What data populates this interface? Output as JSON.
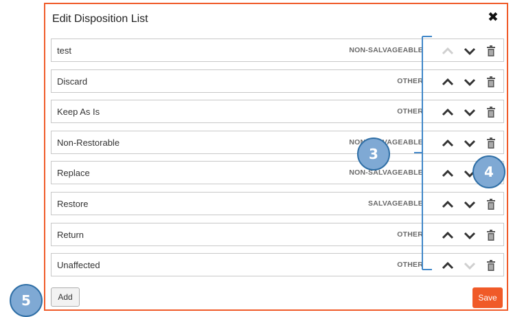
{
  "dialog": {
    "title": "Edit Disposition List",
    "close_icon": "close-x-icon",
    "add_label": "Add",
    "save_label": "Save",
    "accent_color": "#f05a28"
  },
  "items": [
    {
      "name": "test",
      "category": "NON-SALVAGEABLE",
      "up_enabled": false,
      "down_enabled": true
    },
    {
      "name": "Discard",
      "category": "OTHER",
      "up_enabled": true,
      "down_enabled": true
    },
    {
      "name": "Keep As Is",
      "category": "OTHER",
      "up_enabled": true,
      "down_enabled": true
    },
    {
      "name": "Non-Restorable",
      "category": "NON-SALVAGEABLE",
      "up_enabled": true,
      "down_enabled": true
    },
    {
      "name": "Replace",
      "category": "NON-SALVAGEABLE",
      "up_enabled": true,
      "down_enabled": true
    },
    {
      "name": "Restore",
      "category": "SALVAGEABLE",
      "up_enabled": true,
      "down_enabled": true
    },
    {
      "name": "Return",
      "category": "OTHER",
      "up_enabled": true,
      "down_enabled": true
    },
    {
      "name": "Unaffected",
      "category": "OTHER",
      "up_enabled": true,
      "down_enabled": false
    }
  ],
  "callouts": {
    "c3": "3",
    "c4": "4",
    "c5": "5",
    "color": "#7fa9d4"
  }
}
